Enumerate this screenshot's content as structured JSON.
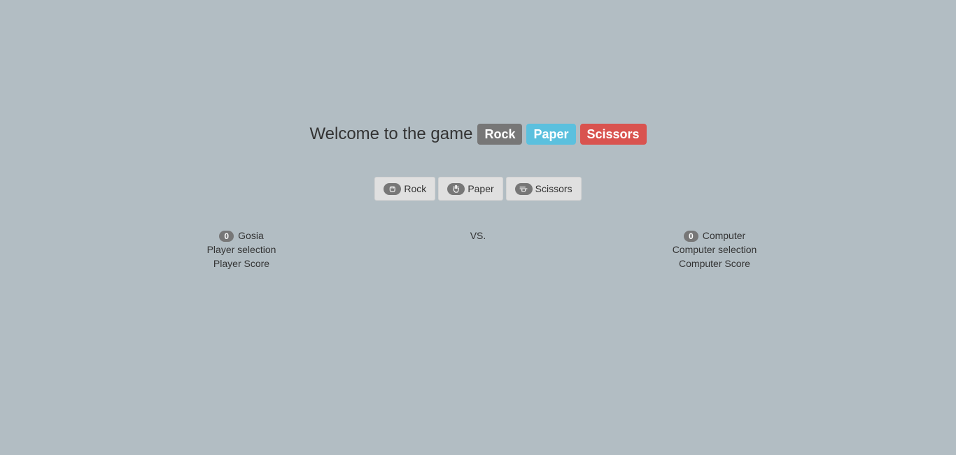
{
  "header": {
    "welcome_text": "Welcome to the game",
    "labels": [
      {
        "text": "Rock",
        "color": "#777777"
      },
      {
        "text": "Paper",
        "color": "#5bc0de"
      },
      {
        "text": "Scissors",
        "color": "#d9534f"
      }
    ]
  },
  "buttons": [
    {
      "label": "Rock",
      "icon": "hand-rock-icon"
    },
    {
      "label": "Paper",
      "icon": "hand-paper-icon"
    },
    {
      "label": "Scissors",
      "icon": "hand-scissors-icon"
    }
  ],
  "player": {
    "score": "0",
    "name": "Gosia",
    "selection_label": "Player selection",
    "score_label": "Player Score"
  },
  "vs_text": "VS.",
  "computer": {
    "score": "0",
    "name": "Computer",
    "selection_label": "Computer selection",
    "score_label": "Computer Score"
  },
  "colors": {
    "background": "#b2bdc3",
    "button_bg": "#e0e0e0",
    "badge": "#777777"
  }
}
